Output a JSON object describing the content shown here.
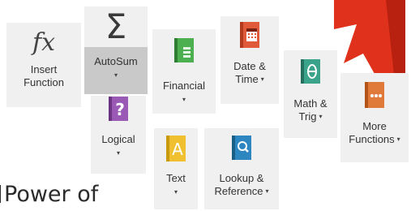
{
  "ribbon": {
    "insert_function": {
      "line1": "Insert",
      "line2": "Function",
      "icon": "fx-icon"
    },
    "autosum": {
      "label": "AutoSum",
      "icon": "sigma-icon"
    },
    "financial": {
      "label": "Financial",
      "icon": "financial-book-icon",
      "color": "#4caf50"
    },
    "date_time": {
      "line1": "Date &",
      "line2": "Time",
      "icon": "calendar-book-icon",
      "color": "#e05a3a"
    },
    "math_trig": {
      "line1": "Math &",
      "line2": "Trig",
      "icon": "theta-book-icon",
      "color": "#3aa38a"
    },
    "more_functions": {
      "line1": "More",
      "line2": "Functions",
      "icon": "ellipsis-book-icon",
      "color": "#e07a3a"
    },
    "logical": {
      "label": "Logical",
      "icon": "question-book-icon",
      "color": "#9b59b6"
    },
    "text": {
      "label": "Text",
      "icon": "text-book-icon",
      "color": "#f0c030"
    },
    "lookup_reference": {
      "line1": "Lookup &",
      "line2": "Reference",
      "icon": "search-book-icon",
      "color": "#2e86c1"
    },
    "caret": "▾"
  },
  "background_title": "Power of",
  "arrow_color": "#e0311c"
}
